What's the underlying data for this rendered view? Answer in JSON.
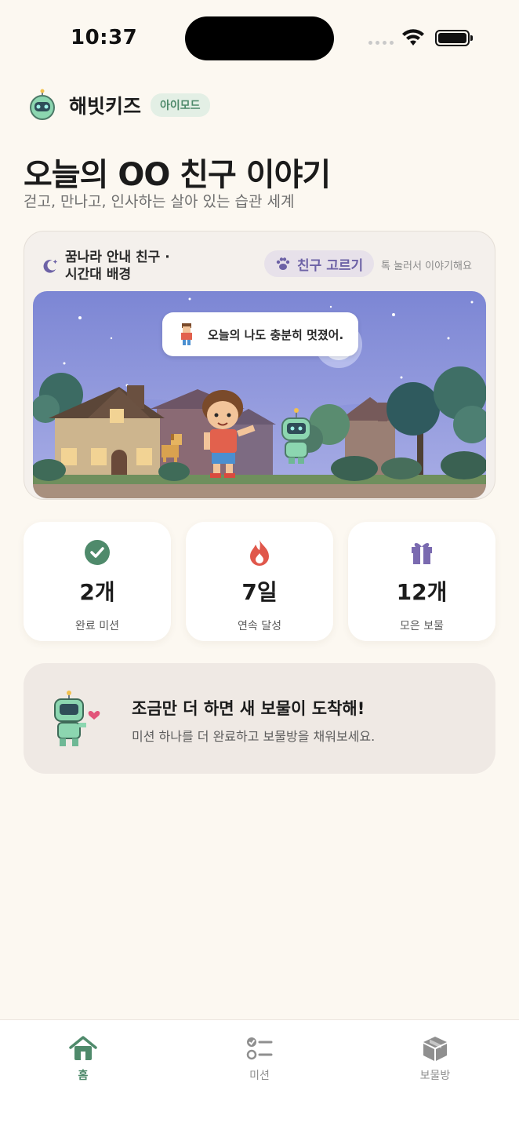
{
  "status_bar": {
    "time": "10:37"
  },
  "header": {
    "brand_name": "해빗키즈",
    "mode_badge": "아이모드",
    "title": "오늘의 OO 친구 이야기",
    "subtitle": "걷고, 만나고, 인사하는 살아 있는 습관 세계"
  },
  "scene": {
    "label": "꿈나라 안내 친구 · 시간대 배경",
    "pick_button": "친구 고르기",
    "hint": "톡 눌러서 이야기해요",
    "bubble_text": "오늘의 나도 충분히 멋졌어."
  },
  "stats": [
    {
      "value": "2개",
      "label": "완료 미션",
      "icon": "check-circle-icon",
      "color": "#4f8a6b"
    },
    {
      "value": "7일",
      "label": "연속 달성",
      "icon": "flame-icon",
      "color": "#e0574b"
    },
    {
      "value": "12개",
      "label": "모은 보물",
      "icon": "gift-icon",
      "color": "#7a6ab0"
    }
  ],
  "promo": {
    "title": "조금만 더 하면 새 보물이 도착해!",
    "subtitle": "미션 하나를 더 완료하고 보물방을 채워보세요."
  },
  "tabs": [
    {
      "label": "홈",
      "icon": "home-icon",
      "active": true
    },
    {
      "label": "미션",
      "icon": "checklist-icon",
      "active": false
    },
    {
      "label": "보물방",
      "icon": "box-icon",
      "active": false
    }
  ],
  "colors": {
    "accent_green": "#4f8a6b",
    "accent_purple": "#6d62a6",
    "background": "#fcf8f1"
  }
}
